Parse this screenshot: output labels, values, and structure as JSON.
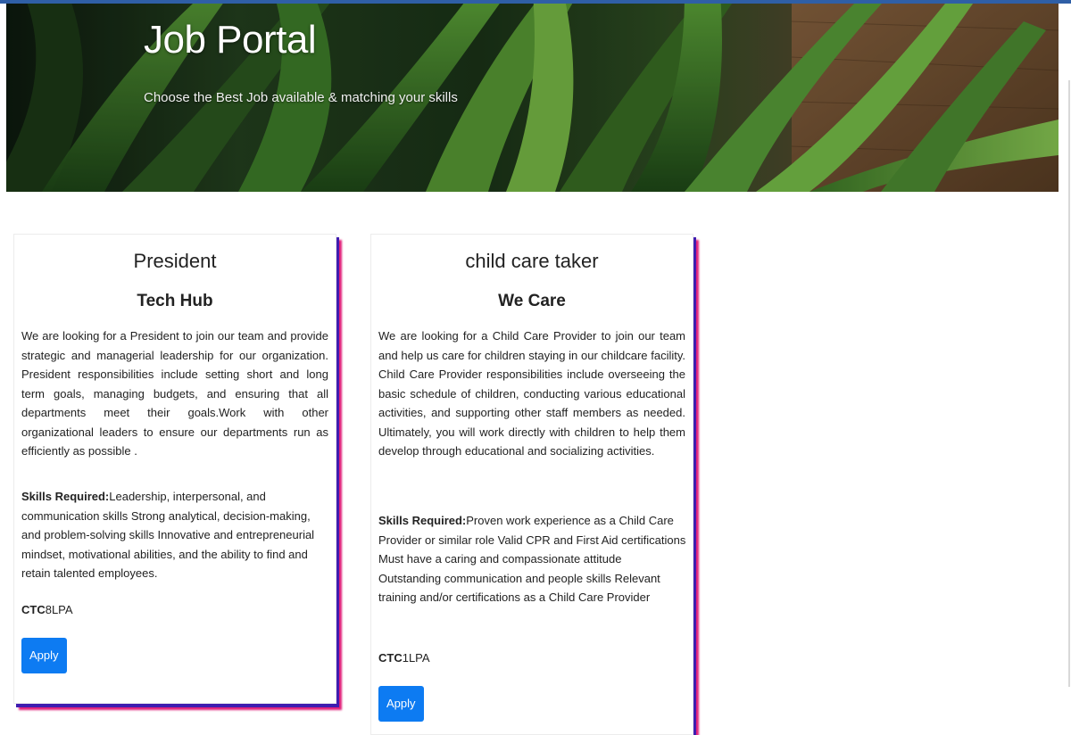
{
  "header": {
    "title": "Job Portal",
    "subtitle": "Choose the Best Job available & matching your skills"
  },
  "jobs": [
    {
      "title": "President",
      "company": "Tech Hub",
      "description": "We are looking for a President to join our team and provide strategic and managerial leadership for our organization. President responsibilities include setting short and long term goals, managing budgets, and ensuring that all departments meet their goals.Work with other organizational leaders to ensure our departments run as efficiently as possible .",
      "skills_label": "Skills Required:",
      "skills": "Leadership, interpersonal, and communication skills Strong analytical, decision-making, and problem-solving skills Innovative and entrepreneurial mindset, motivational abilities, and the ability to find and retain talented employees.",
      "ctc_label": "CTC",
      "ctc_value": "8LPA",
      "apply_label": "Apply"
    },
    {
      "title": "child care taker",
      "company": "We Care",
      "description": "We are looking for a Child Care Provider to join our team and help us care for children staying in our childcare facility. Child Care Provider responsibilities include overseeing the basic schedule of children, conducting various educational activities, and supporting other staff members as needed. Ultimately, you will work directly with children to help them develop through educational and socializing activities.",
      "skills_label": "Skills Required:",
      "skills": "Proven work experience as a Child Care Provider or similar role Valid CPR and First Aid certifications Must have a caring and compassionate attitude Outstanding communication and people skills Relevant training and/or certifications as a Child Care Provider",
      "ctc_label": "CTC",
      "ctc_value": "1LPA",
      "apply_label": "Apply"
    }
  ],
  "colors": {
    "accent": "#0d7bf2",
    "card_shadow_primary": "#3f1db0",
    "card_shadow_secondary": "#e0207a",
    "top_line": "#2f5fa6"
  }
}
